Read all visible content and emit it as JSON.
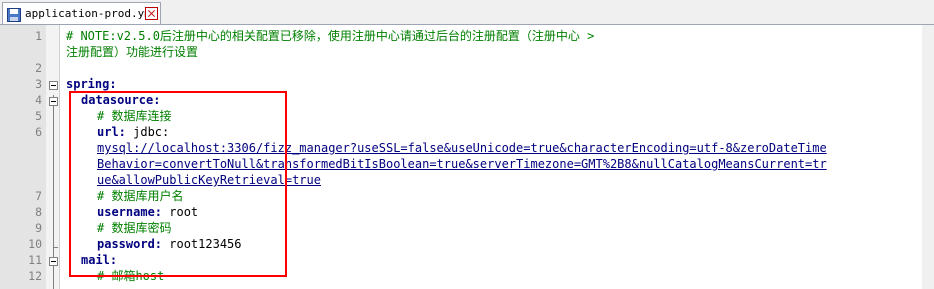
{
  "tab": {
    "filename": "application-prod.yml"
  },
  "lines": [
    {
      "number": "1",
      "text": "# NOTE:v2.5.0后注册中心的相关配置已移除，使用注册中心请通过后台的注册配置（注册中心 >"
    },
    {
      "number": "",
      "text": "注册配置）功能进行设置"
    },
    {
      "number": "2",
      "text": ""
    },
    {
      "number": "3",
      "text": "spring:"
    },
    {
      "number": "4",
      "text": "datasource:"
    },
    {
      "number": "5",
      "text": "# 数据库连接"
    },
    {
      "number": "6",
      "text": "url: jdbc:"
    },
    {
      "number": "",
      "text": "mysql://localhost:3306/fizz_manager?useSSL=false&useUnicode=true&characterEncoding=utf-8&zeroDateTime"
    },
    {
      "number": "",
      "text": "Behavior=convertToNull&transformedBitIsBoolean=true&serverTimezone=GMT%2B8&nullCatalogMeansCurrent=tr"
    },
    {
      "number": "",
      "text": "ue&allowPublicKeyRetrieval=true"
    },
    {
      "number": "7",
      "text": "# 数据库用户名"
    },
    {
      "number": "8",
      "text": "username: root"
    },
    {
      "number": "9",
      "text": "# 数据库密码"
    },
    {
      "number": "10",
      "text": "password: root123456"
    },
    {
      "number": "11",
      "text": "mail:"
    },
    {
      "number": "12",
      "text": "# 邮箱host"
    }
  ],
  "colors": {
    "comment": "#008000",
    "key": "#000080",
    "highlight": "#ff0000"
  }
}
